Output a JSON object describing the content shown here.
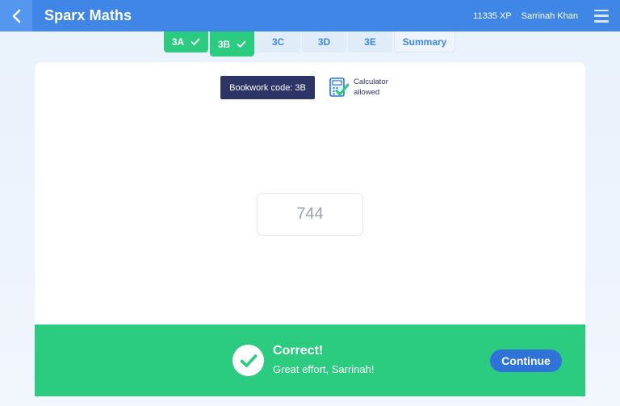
{
  "header": {
    "title": "Sparx Maths",
    "xp": "11335 XP",
    "user_name": "Sarrinah Khan",
    "back_icon": "chevron-left-icon",
    "menu_icon": "hamburger-menu-icon"
  },
  "tabs": [
    {
      "label": "3A",
      "status": "complete",
      "active": false
    },
    {
      "label": "3B",
      "status": "complete",
      "active": true
    },
    {
      "label": "3C",
      "status": "pending",
      "active": false
    },
    {
      "label": "3D",
      "status": "pending",
      "active": false
    },
    {
      "label": "3E",
      "status": "pending",
      "active": false
    },
    {
      "label": "Summary",
      "status": "pending",
      "active": false
    }
  ],
  "question": {
    "bookwork_code": "Bookwork code: 3B",
    "calculator_line1": "Calculator",
    "calculator_line2": "allowed",
    "answer_value": "744"
  },
  "feedback": {
    "title": "Correct!",
    "message": "Great effort, Sarrinah!",
    "continue_label": "Continue",
    "icon": "check-circle-icon"
  },
  "colors": {
    "brand_blue": "#3f86e6",
    "success_green": "#2bcb80",
    "navy": "#2c3566",
    "button_blue": "#2f73d8"
  }
}
